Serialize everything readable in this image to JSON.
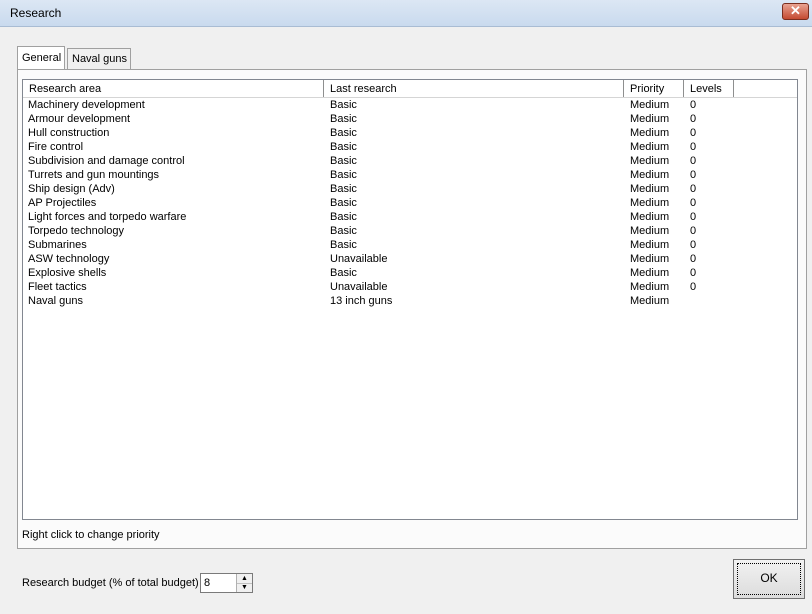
{
  "window": {
    "title": "Research",
    "close_glyph": "✕"
  },
  "tabs": [
    {
      "label": "General",
      "active": true
    },
    {
      "label": "Naval guns",
      "active": false
    }
  ],
  "table": {
    "columns": [
      "Research area",
      "Last research",
      "Priority",
      "Levels"
    ],
    "rows": [
      [
        "Machinery development",
        "Basic",
        "Medium",
        "0"
      ],
      [
        "Armour development",
        "Basic",
        "Medium",
        "0"
      ],
      [
        "Hull construction",
        "Basic",
        "Medium",
        "0"
      ],
      [
        "Fire control",
        "Basic",
        "Medium",
        "0"
      ],
      [
        "Subdivision and damage control",
        "Basic",
        "Medium",
        "0"
      ],
      [
        "Turrets and gun mountings",
        "Basic",
        "Medium",
        "0"
      ],
      [
        "Ship design (Adv)",
        "Basic",
        "Medium",
        "0"
      ],
      [
        "AP Projectiles",
        "Basic",
        "Medium",
        "0"
      ],
      [
        "Light forces and torpedo warfare",
        "Basic",
        "Medium",
        "0"
      ],
      [
        "Torpedo technology",
        "Basic",
        "Medium",
        "0"
      ],
      [
        "Submarines",
        "Basic",
        "Medium",
        "0"
      ],
      [
        "ASW technology",
        "Unavailable",
        "Medium",
        "0"
      ],
      [
        "Explosive shells",
        "Basic",
        "Medium",
        "0"
      ],
      [
        "Fleet tactics",
        "Unavailable",
        "Medium",
        "0"
      ],
      [
        "Naval guns",
        "13 inch guns",
        "Medium",
        ""
      ]
    ]
  },
  "hint": "Right click to change priority",
  "budget": {
    "label": "Research budget (% of total budget)",
    "value": "8"
  },
  "ok_label": "OK",
  "icons": {
    "spin_up": "▲",
    "spin_down": "▼"
  }
}
